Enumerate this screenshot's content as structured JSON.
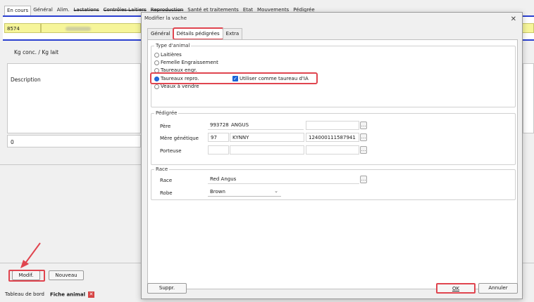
{
  "colors": {
    "accent_blue": "#2a3fd0",
    "highlight_red": "#e0454f",
    "field_yellow": "#f6f59a",
    "check_blue": "#1a63d8"
  },
  "bg_tabs": [
    {
      "label": "En cours",
      "active": true,
      "strike": false
    },
    {
      "label": "Général",
      "active": false,
      "strike": false
    },
    {
      "label": "Alim.",
      "active": false,
      "strike": false
    },
    {
      "label": "Lactations",
      "active": false,
      "strike": true
    },
    {
      "label": "Contrôles Laitiers",
      "active": false,
      "strike": true
    },
    {
      "label": "Reproduction",
      "active": false,
      "strike": true
    },
    {
      "label": "Santé et traitements",
      "active": false,
      "strike": false
    },
    {
      "label": "Etat",
      "active": false,
      "strike": false
    },
    {
      "label": "Mouvements",
      "active": false,
      "strike": false
    },
    {
      "label": "Pédigrée",
      "active": false,
      "strike": false
    }
  ],
  "header": {
    "animal_id": "8574"
  },
  "bg_fields": {
    "kg_conc_label": "Kg conc. / Kg lait",
    "description_label": "Description",
    "zero_value": "0"
  },
  "bg_buttons": {
    "modif": "Modif.",
    "nouveau": "Nouveau"
  },
  "bottom_tabs": [
    {
      "label": "Tableau de bord",
      "active": false
    },
    {
      "label": "Fiche animal",
      "active": true
    }
  ],
  "dialog": {
    "title": "Modifier la vache",
    "close_icon": "close-icon",
    "tabs": [
      {
        "label": "Général",
        "active": false
      },
      {
        "label": "Détails pédigrées",
        "active": true
      },
      {
        "label": "Extra",
        "active": false
      }
    ],
    "type_animal": {
      "title": "Type d'animal",
      "options": [
        {
          "label": "Laitières",
          "checked": false
        },
        {
          "label": "Femelle Engraissement",
          "checked": false
        },
        {
          "label": "Taureaux engr.",
          "checked": false
        },
        {
          "label": "Taureaux repro.",
          "checked": true
        },
        {
          "label": "Veaux à vendre",
          "checked": false
        }
      ],
      "ia_checkbox_label": "Utiliser comme taureau d'IA",
      "ia_checked": true
    },
    "pedigree": {
      "title": "Pédigrée",
      "rows": [
        {
          "label": "Père",
          "code": "993728",
          "name": "ANGUS",
          "id": ""
        },
        {
          "label": "Mère génétique",
          "code": "97",
          "name": "KYNNY",
          "id": "124000111587941"
        },
        {
          "label": "Porteuse",
          "code": "",
          "name": "",
          "id": ""
        }
      ]
    },
    "race": {
      "title": "Race",
      "race_label": "Race",
      "race_value": "Red Angus",
      "robe_label": "Robe",
      "robe_value": "Brown"
    },
    "buttons": {
      "suppr": "Suppr.",
      "ok": "OK",
      "annuler": "Annuler"
    }
  }
}
